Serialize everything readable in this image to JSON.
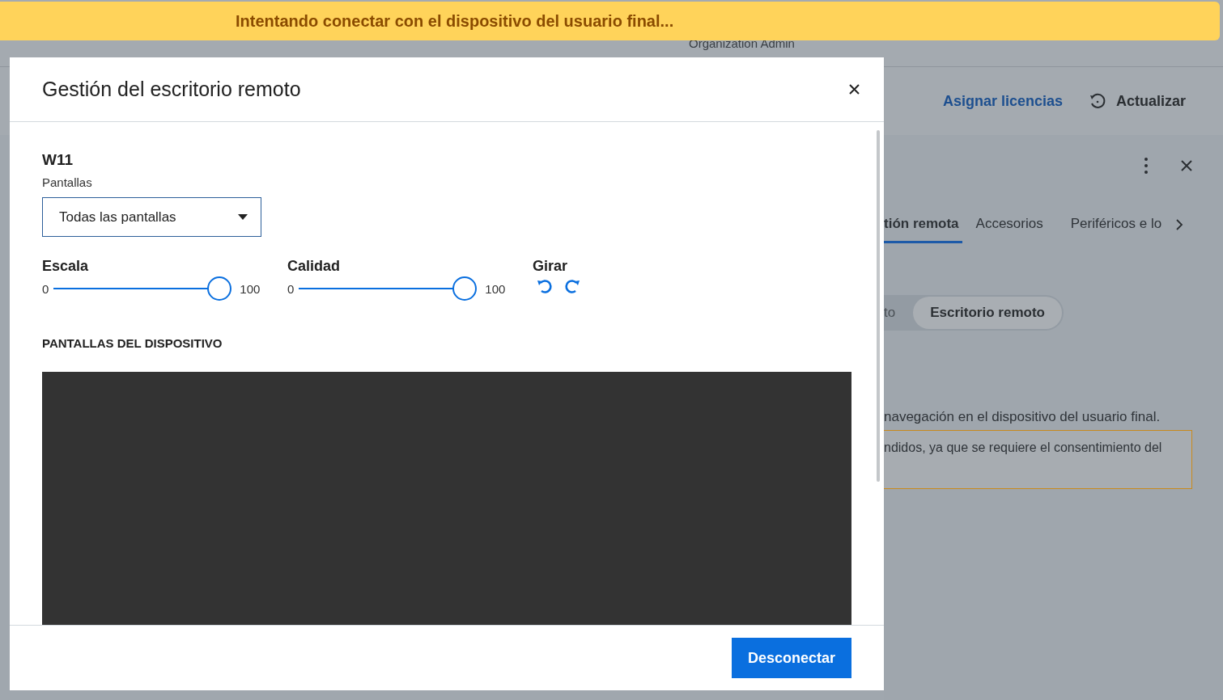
{
  "banner": {
    "text": "Intentando conectar con el dispositivo del usuario final..."
  },
  "background": {
    "user_role": "Organization Admin",
    "toolbar": {
      "assign_link": "Asignar licencias",
      "refresh_button": "Actualizar"
    },
    "panel": {
      "tabs": [
        {
          "label": "tión remota",
          "selected": true
        },
        {
          "label": "Accesorios",
          "selected": false
        },
        {
          "label": "Periféricos e lo",
          "selected": false
        }
      ],
      "segments": [
        {
          "label": "to",
          "selected": false
        },
        {
          "label": "Escritorio remoto",
          "selected": true
        }
      ],
      "description": "navegación en el dispositivo del usuario final.",
      "warning": "ndidos, ya que se requiere el consentimiento del"
    }
  },
  "dialog": {
    "title": "Gestión del escritorio remoto",
    "device_name": "W11",
    "screens_label": "Pantallas",
    "screens_select": "Todas las pantallas",
    "sliders": [
      {
        "label": "Escala",
        "min": "0",
        "max": "100",
        "level": 1
      },
      {
        "label": "Calidad",
        "min": "0",
        "max": "100",
        "level": 1
      }
    ],
    "rotate_label": "Girar",
    "section_title": "PANTALLAS DEL DISPOSITIVO",
    "disconnect_button": "Desconectar"
  }
}
